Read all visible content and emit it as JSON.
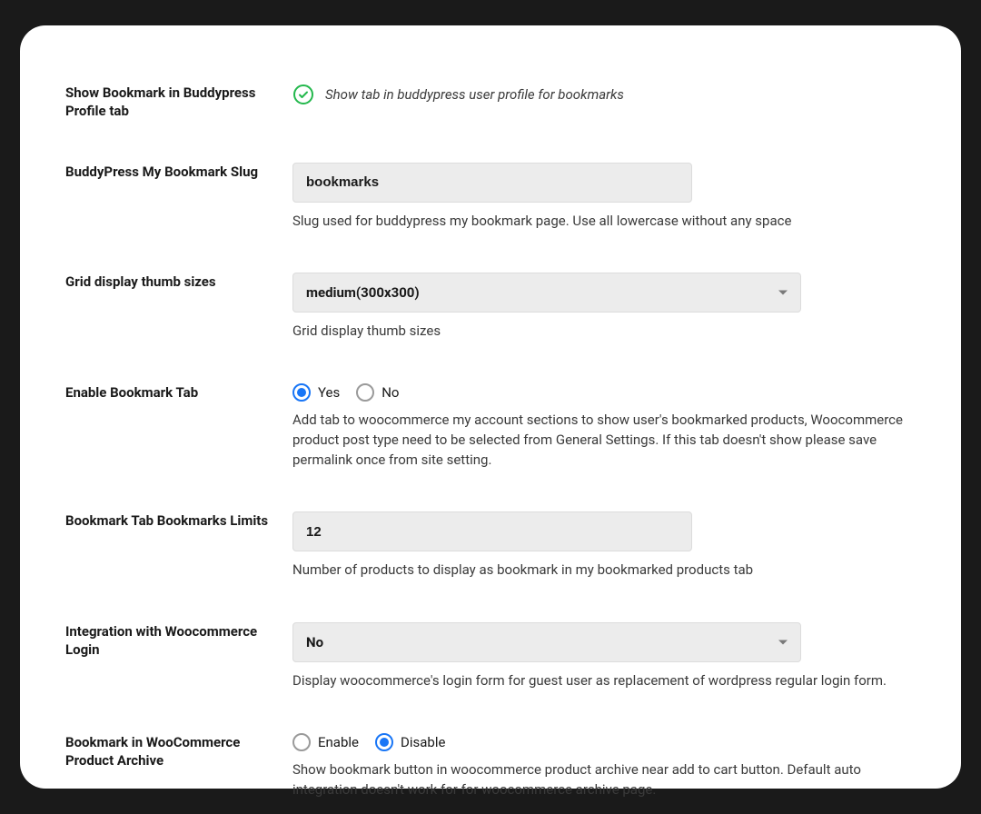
{
  "fields": {
    "show_bookmark_bp": {
      "label": "Show Bookmark in Buddypress Profile tab",
      "note": "Show tab in buddypress user profile for bookmarks"
    },
    "bp_slug": {
      "label": "BuddyPress My Bookmark Slug",
      "value": "bookmarks",
      "help": "Slug used for buddypress my bookmark page. Use all lowercase without any space"
    },
    "grid_thumb": {
      "label": "Grid display thumb sizes",
      "selected": "medium(300x300)",
      "help": "Grid display thumb sizes"
    },
    "enable_tab": {
      "label": "Enable Bookmark Tab",
      "opt_yes": "Yes",
      "opt_no": "No",
      "help": "Add tab to woocommerce my account sections to show user's bookmarked products, Woocommerce product post type need to be selected from General Settings. If this tab doesn't show please save permalink once from site setting."
    },
    "tab_limit": {
      "label": "Bookmark Tab Bookmarks Limits",
      "value": "12",
      "help": "Number of products to display as bookmark in my bookmarked products tab"
    },
    "woo_login": {
      "label": "Integration with Woocommerce Login",
      "selected": "No",
      "help": "Display woocommerce's login form for guest user as replacement of wordpress regular login form."
    },
    "woo_archive": {
      "label": "Bookmark in WooCommerce Product Archive",
      "opt_enable": "Enable",
      "opt_disable": "Disable",
      "help": "Show bookmark button in woocommerce product archive near add to cart button. Default auto integration doesn't work for for woocommerce archive page."
    }
  }
}
